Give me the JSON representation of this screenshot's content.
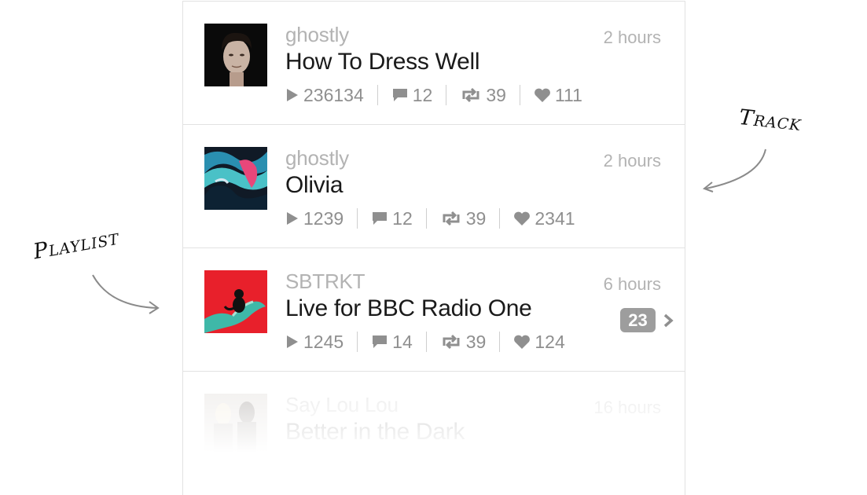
{
  "feed": {
    "items": [
      {
        "user": "ghostly",
        "title": "How To Dress Well",
        "time": "2 hours",
        "plays": "236134",
        "comments": "12",
        "reposts": "39",
        "likes": "111",
        "artwork_icon": "portrait-photo"
      },
      {
        "user": "ghostly",
        "title": "Olivia",
        "time": "2 hours",
        "plays": "1239",
        "comments": "12",
        "reposts": "39",
        "likes": "2341",
        "artwork_icon": "abstract-paint-art"
      },
      {
        "user": "SBTRKT",
        "title": "Live for BBC Radio One",
        "time": "6 hours",
        "plays": "1245",
        "comments": "14",
        "reposts": "39",
        "likes": "124",
        "track_count": "23",
        "artwork_icon": "hand-figure-art"
      },
      {
        "user": "Say Lou Lou",
        "title": "Better in the Dark",
        "time": "16 hours",
        "artwork_icon": "group-photo"
      }
    ]
  },
  "annotations": {
    "track": "Track",
    "playlist": "Playlist"
  },
  "colors": {
    "secondary_text": "#b3b3b3",
    "primary_text": "#1a1a1a",
    "stat_gray": "#8f8f8f",
    "badge": "#9d9d9d",
    "divider": "#e2e2e2"
  }
}
